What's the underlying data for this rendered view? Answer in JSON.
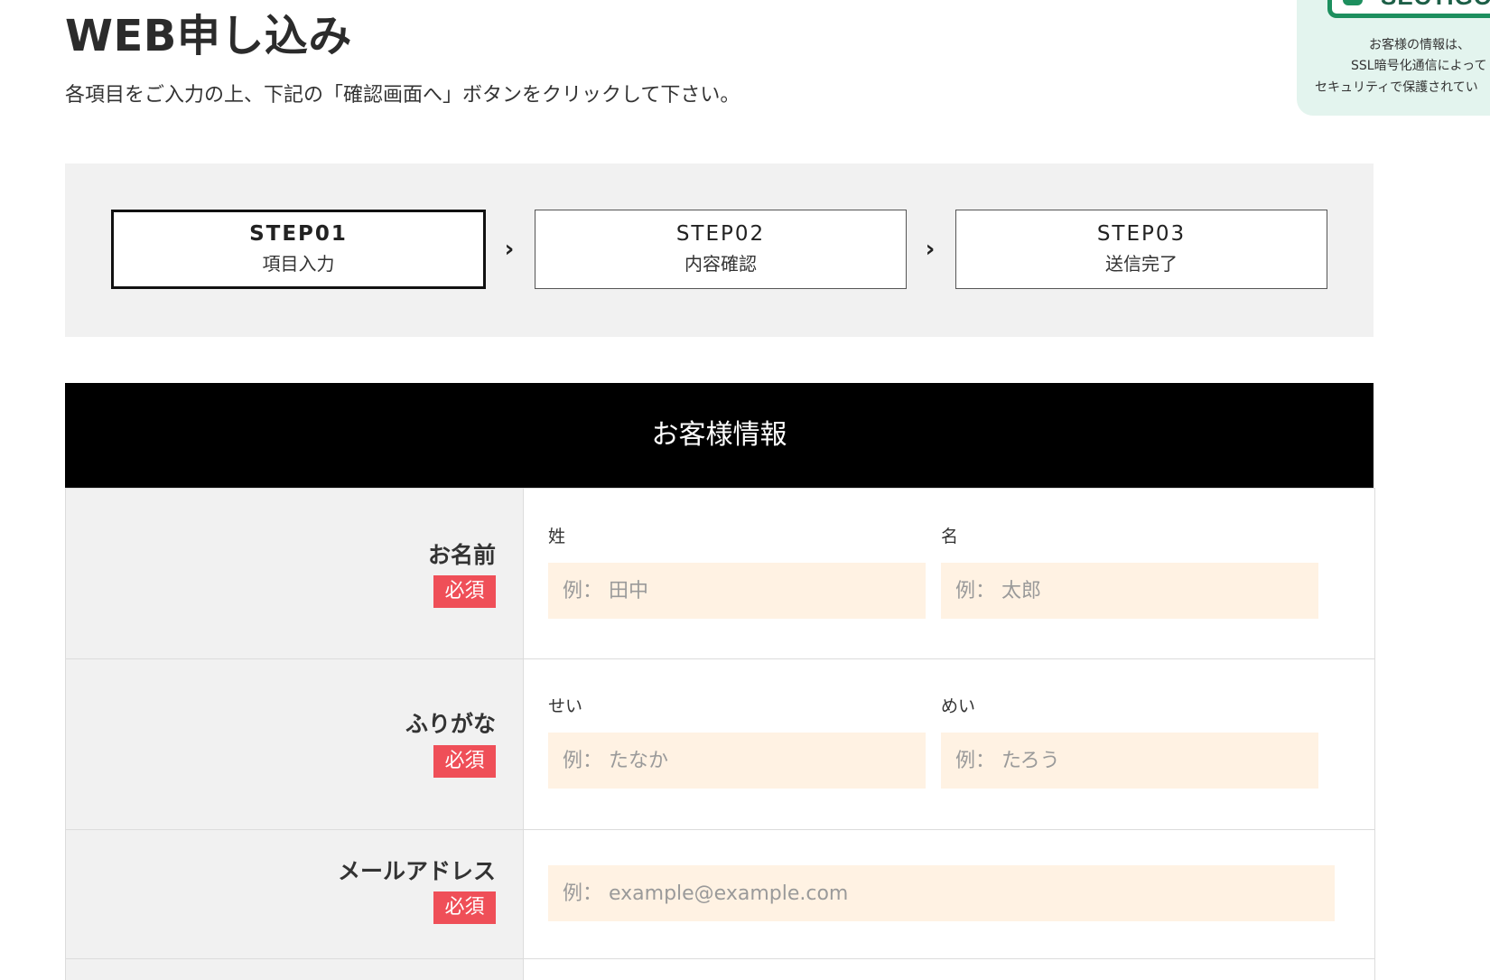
{
  "header": {
    "title": "WEB申し込み",
    "description": "各項目をご入力の上、下記の「確認画面へ」ボタンをクリックして下さい。"
  },
  "ssl_badge": {
    "logo_text": "SECTIGO",
    "line1": "お客様の情報は、",
    "line2": "SSL暗号化通信によって",
    "line3": "セキュリティで保護されてい"
  },
  "steps": [
    {
      "number": "STEP01",
      "label": "項目入力",
      "active": true
    },
    {
      "number": "STEP02",
      "label": "内容確認",
      "active": false
    },
    {
      "number": "STEP03",
      "label": "送信完了",
      "active": false
    }
  ],
  "step_arrow": "›",
  "section": {
    "title": "お客様情報"
  },
  "form": {
    "required_label": "必須",
    "name": {
      "label": "お名前",
      "last_label": "姓",
      "last_placeholder": "例： 田中",
      "first_label": "名",
      "first_placeholder": "例： 太郎"
    },
    "furigana": {
      "label": "ふりがな",
      "last_label": "せい",
      "last_placeholder": "例： たなか",
      "first_label": "めい",
      "first_placeholder": "例： たろう"
    },
    "email": {
      "label": "メールアドレス",
      "placeholder": "例： example@example.com"
    }
  },
  "colors": {
    "required_badge": "#ef4f58",
    "input_bg": "#fff2e3",
    "section_header_bg": "#000000",
    "steps_panel_bg": "#f1f1f1",
    "ssl_badge_bg": "#e3f4ee",
    "ssl_brand": "#1d8f5e"
  }
}
